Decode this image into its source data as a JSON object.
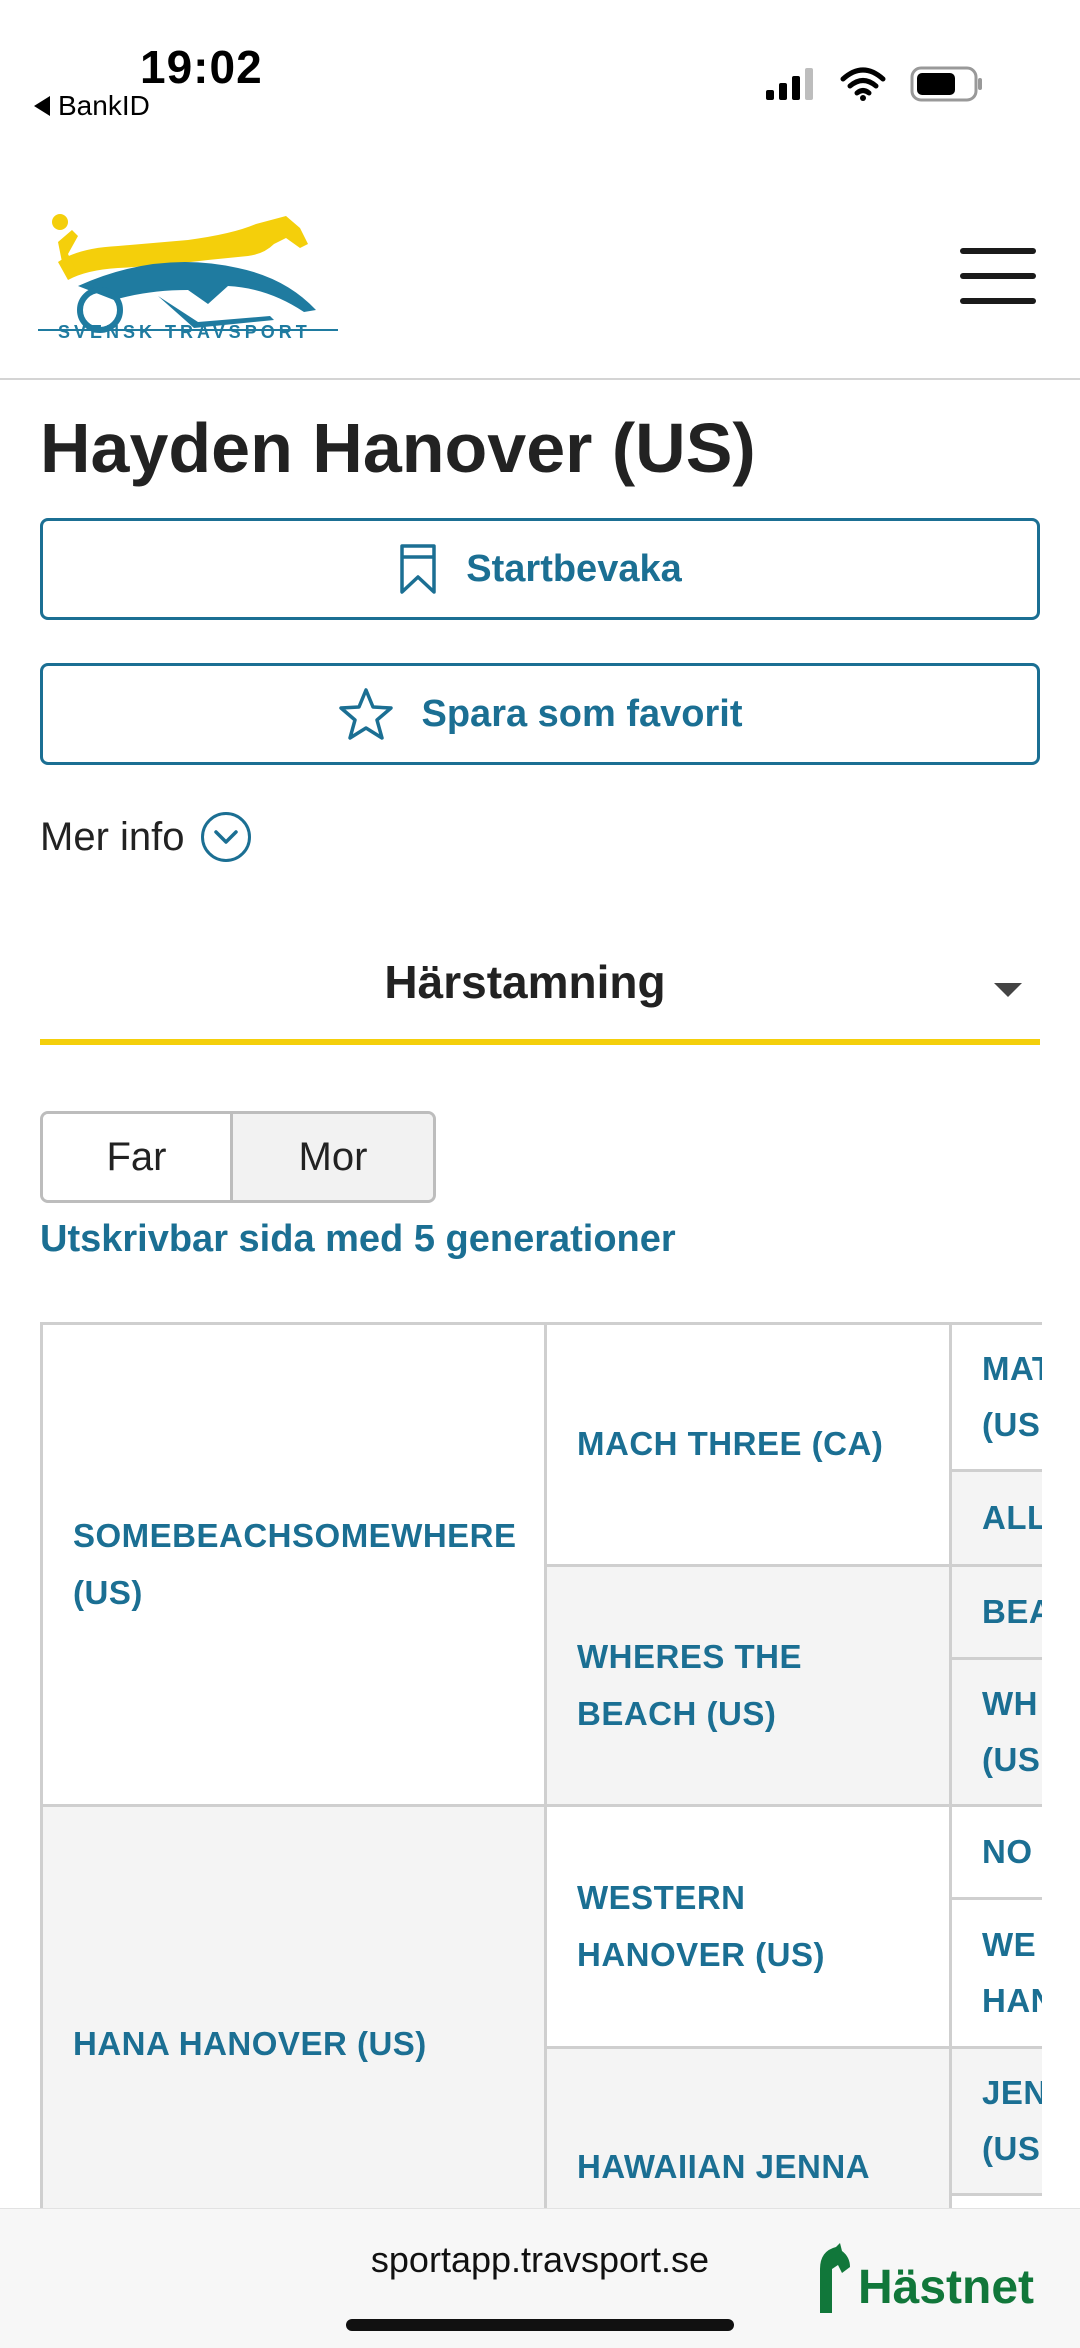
{
  "status_bar": {
    "time": "19:02",
    "back_app": "BankID"
  },
  "header": {
    "logo_text": "SVENSK TRAVSPORT",
    "colors": {
      "logo_yellow": "#f4cf0b",
      "logo_blue": "#1f7ba0"
    }
  },
  "page": {
    "title": "Hayden Hanover (US)"
  },
  "actions": {
    "watch_label": "Startbevaka",
    "favorite_label": "Spara som favorit",
    "more_info_label": "Mer info"
  },
  "section": {
    "selected": "Härstamning"
  },
  "parent_toggle": {
    "far": "Far",
    "mor": "Mor",
    "active": "Mor"
  },
  "print_link": "Utskrivbar sida med 5 generationer",
  "pedigree": {
    "sire": [
      "SOMEBEACHSOMEWHERE",
      "(US)"
    ],
    "dam": [
      "HANA HANOVER (US)"
    ],
    "sire_sire": [
      "MACH THREE (CA)"
    ],
    "sire_dam": [
      "WHERES THE",
      "BEACH (US)"
    ],
    "dam_sire": [
      "WESTERN",
      "HANOVER (US)"
    ],
    "dam_dam": [
      "HAWAIIAN JENNA"
    ],
    "gen3": [
      [
        "MAT",
        "(US"
      ],
      [
        "ALL"
      ],
      [
        "BEA"
      ],
      [
        "WH",
        "(US"
      ],
      [
        "NO"
      ],
      [
        "WE",
        "HAN"
      ],
      [
        "JEN",
        "(US"
      ]
    ]
  },
  "bottom_bar": {
    "url": "sportapp.travsport.se",
    "brand": "Hästnet"
  },
  "colors": {
    "accent": "#1b6f93",
    "underline": "#f4cf0b",
    "brand_green": "#11773a"
  }
}
